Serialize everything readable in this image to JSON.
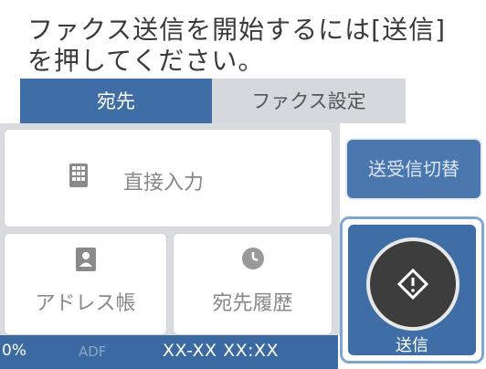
{
  "instruction": "ファクス送信を開始するには[送信]\nを押してください。",
  "tabs": [
    {
      "label": "宛先",
      "active": true
    },
    {
      "label": "ファクス設定",
      "active": false
    }
  ],
  "buttons": {
    "direct_input": "直接入力",
    "address_book": "アドレス帳",
    "history": "宛先履歴",
    "send_receive_switch": "送受信切替",
    "send": "送信"
  },
  "icons": {
    "direct_input": "keypad-icon",
    "address_book": "contacts-icon",
    "history": "clock-icon",
    "send": "start-diamond-icon"
  },
  "status": {
    "percent": "0%",
    "adf": "ADF",
    "time": "XX-XX XX:XX"
  },
  "colors": {
    "accent": "#3f6ea6",
    "tab_inactive": "#d5d8dd",
    "send_circle": "#3d3d3d"
  }
}
